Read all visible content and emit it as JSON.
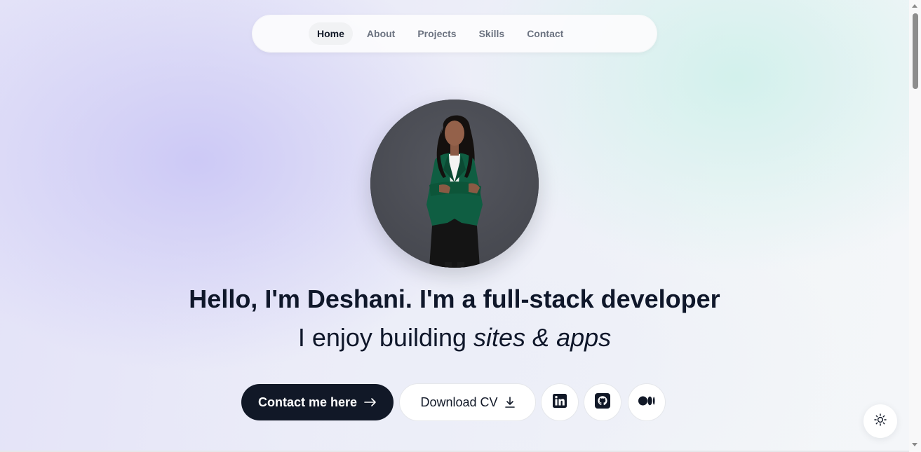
{
  "nav": {
    "items": [
      {
        "label": "Home",
        "active": true
      },
      {
        "label": "About",
        "active": false
      },
      {
        "label": "Projects",
        "active": false
      },
      {
        "label": "Skills",
        "active": false
      },
      {
        "label": "Contact",
        "active": false
      }
    ]
  },
  "hero": {
    "greeting": "Hello, I'm Deshani.",
    "im_a": "I'm a",
    "role": "full-stack developer",
    "enjoy": "I enjoy building",
    "building_what": "sites & apps"
  },
  "actions": {
    "contact_label": "Contact me here",
    "download_label": "Download CV",
    "social": [
      {
        "icon": "linkedin-icon"
      },
      {
        "icon": "github-icon"
      },
      {
        "icon": "medium-icon"
      }
    ],
    "theme_toggle_icon": "sun-icon"
  },
  "colors": {
    "primary": "#111827",
    "jacket": "#0f5e42",
    "avatar_bg": "#4b4d55"
  }
}
